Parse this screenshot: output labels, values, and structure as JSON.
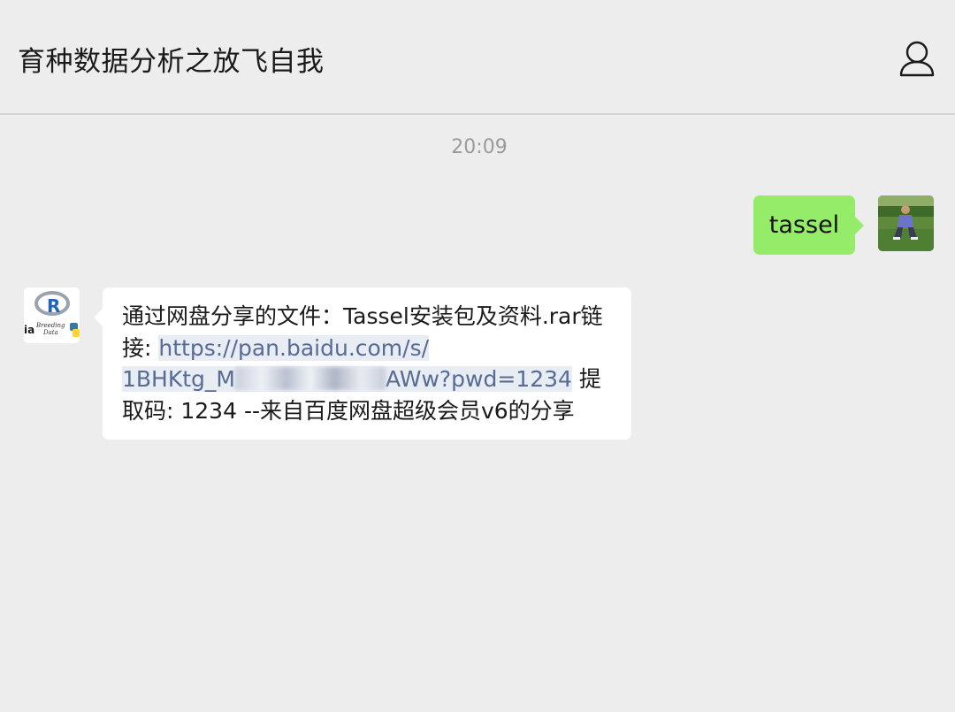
{
  "header": {
    "title": "育种数据分析之放飞自我",
    "profile_icon": "person-icon"
  },
  "chat": {
    "timestamp": "20:09",
    "outgoing": {
      "text": "tassel",
      "bubble_color": "#95ec69"
    },
    "incoming": {
      "line1": "通过网盘分享的文件：Tassel安装包及资料.rar链",
      "line2_prefix": "接: ",
      "link_part1": "https://pan.baidu.com/s/",
      "link_part2_start": "1BHKtg_M",
      "link_part2_end": "AWw?pwd=1234",
      "line3_suffix": " 提",
      "line4": "取码: 1234 --来自百度网盘超级会员v6的分享",
      "link_color": "#576b95"
    },
    "avatar_other_label": "Breeding Data"
  },
  "colors": {
    "background": "#ededed",
    "incoming_bubble": "#ffffff"
  }
}
